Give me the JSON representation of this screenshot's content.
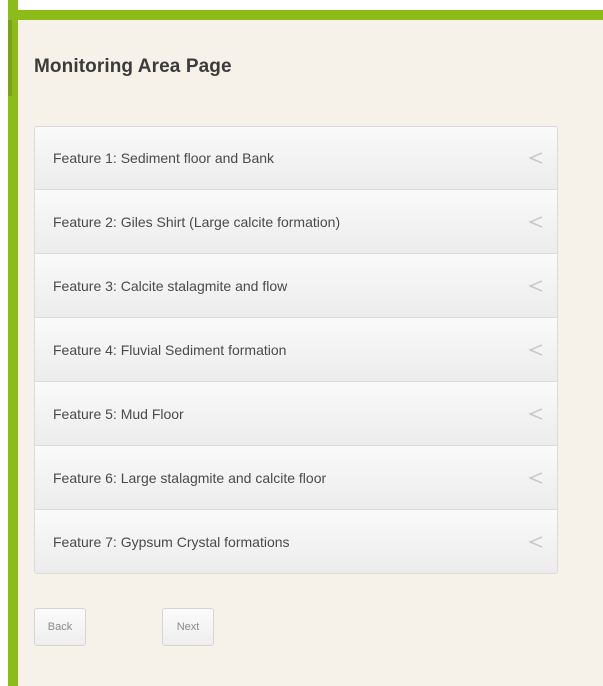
{
  "page": {
    "title": "Monitoring Area Page"
  },
  "features": [
    {
      "label": "Feature 1: Sediment floor and Bank"
    },
    {
      "label": "Feature 2: Giles Shirt (Large calcite formation)"
    },
    {
      "label": "Feature 3: Calcite stalagmite and flow"
    },
    {
      "label": "Feature 4: Fluvial Sediment formation"
    },
    {
      "label": "Feature 5: Mud Floor"
    },
    {
      "label": "Feature 6: Large stalagmite and calcite floor"
    },
    {
      "label": "Feature 7: Gypsum Crystal formations"
    }
  ],
  "nav": {
    "back_label": "Back",
    "next_label": "Next"
  },
  "colors": {
    "frame_green": "#8dbb1a",
    "background": "#f6f2e9"
  },
  "icons": {
    "list_item": "chevron-left-icon"
  }
}
